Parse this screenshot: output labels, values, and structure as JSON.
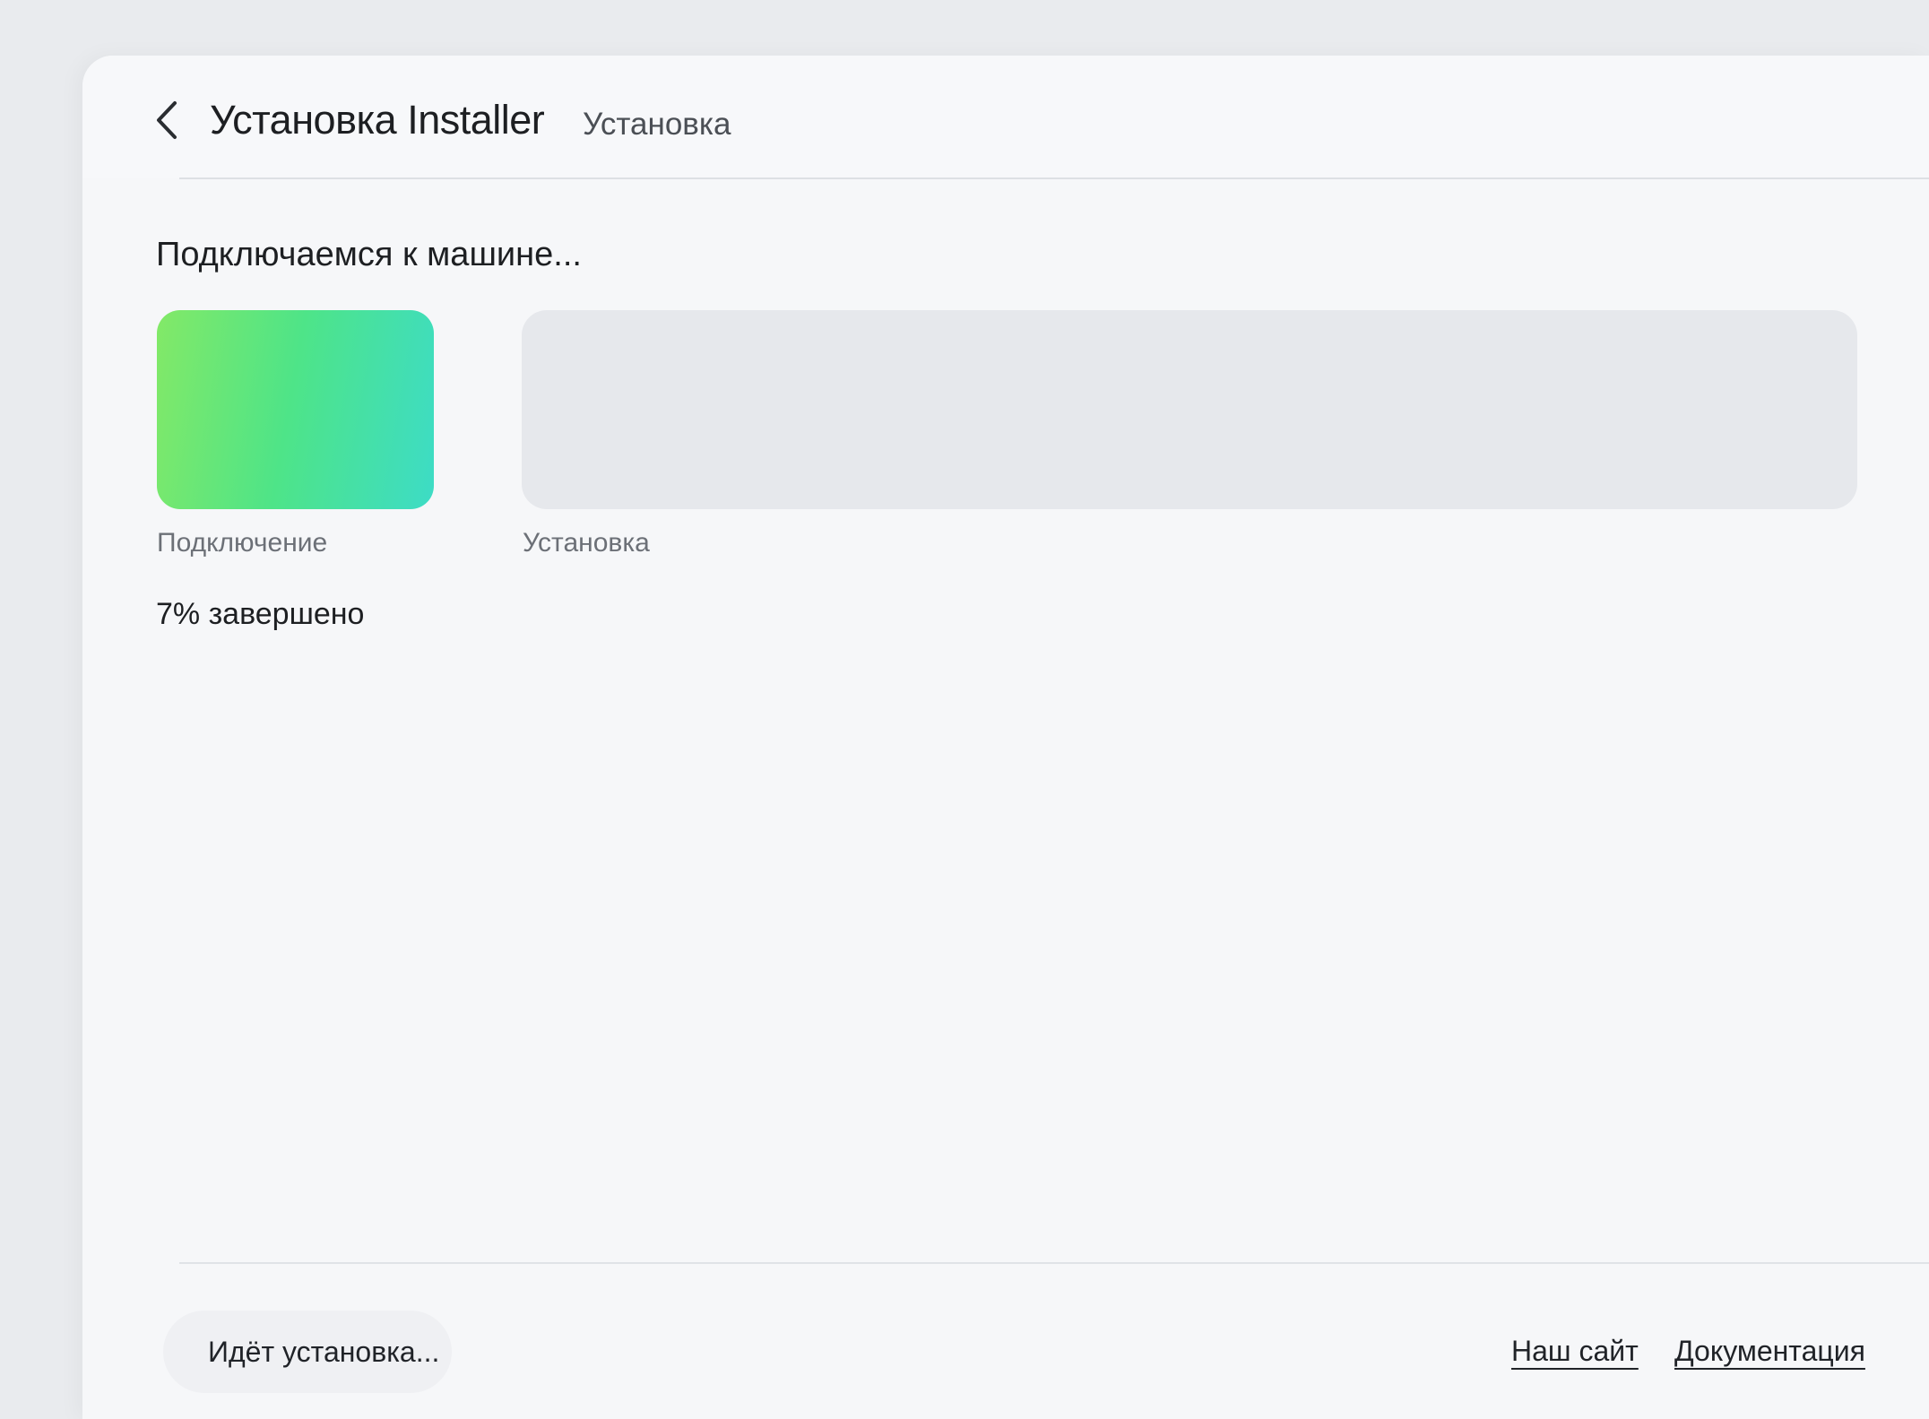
{
  "header": {
    "back_icon": "chevron-left-icon",
    "title": "Установка Installer",
    "subtitle": "Установка"
  },
  "main": {
    "status_heading": "Подключаемся к машине...",
    "stages": [
      {
        "label": "Подключение",
        "state": "complete",
        "color_start": "#83e967",
        "color_end": "#3ddcc6"
      },
      {
        "label": "Установка",
        "state": "pending",
        "color": "#e6e8ec"
      }
    ],
    "progress_percent": 7,
    "progress_text": "7% завершено"
  },
  "footer": {
    "status_button_label": "Идёт установка...",
    "links": [
      {
        "label": "Наш сайт"
      },
      {
        "label": "Документация"
      }
    ]
  }
}
